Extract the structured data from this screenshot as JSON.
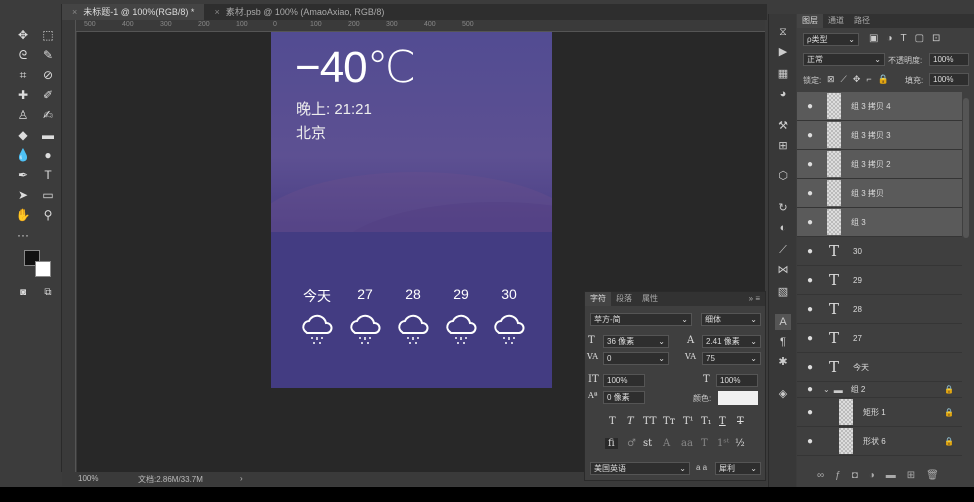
{
  "tabs": [
    {
      "label": "未标题-1 @ 100%(RGB/8) *",
      "active": true
    },
    {
      "label": "素材.psb @ 100% (AmaoAxiao, RGB/8)",
      "active": false
    }
  ],
  "ruler": [
    "500",
    "400",
    "300",
    "200",
    "100",
    "0",
    "100",
    "200",
    "300",
    "400",
    "500"
  ],
  "status": {
    "zoom": "100%",
    "doc": "文档:2.86M/33.7M",
    "arrow": "›"
  },
  "weather": {
    "temp": "−40",
    "unit": "℃",
    "time": "晚上:  21:21",
    "city": "北京",
    "forecast": [
      "今天",
      "27",
      "28",
      "29",
      "30"
    ]
  },
  "character": {
    "tabs": [
      "字符",
      "段落",
      "属性"
    ],
    "font": "苹方-简",
    "style": "细体",
    "size": "36 像素",
    "leading": "2.41 像素",
    "kerning": "0",
    "tracking": "75",
    "vscale": "100%",
    "hscale": "100%",
    "baseline": "0 像素",
    "color_label": "颜色:",
    "language": "美国英语",
    "aa_label": "a a",
    "antialias": "犀利",
    "text_color": "#f0f0f0"
  },
  "layers_panel": {
    "tabs": [
      "图层",
      "通道",
      "路径"
    ],
    "filter": "ρ类型",
    "blend": "正常",
    "opacity_label": "不透明度:",
    "opacity": "100%",
    "lock_label": "锁定:",
    "fill_label": "填充:",
    "fill": "100%",
    "layers": [
      {
        "name": "组 3 拷贝 4",
        "type": "smart"
      },
      {
        "name": "组 3 拷贝 3",
        "type": "smart"
      },
      {
        "name": "组 3 拷贝 2",
        "type": "smart"
      },
      {
        "name": "组 3 拷贝",
        "type": "smart"
      },
      {
        "name": "组 3",
        "type": "smart"
      },
      {
        "name": "30",
        "type": "text"
      },
      {
        "name": "29",
        "type": "text"
      },
      {
        "name": "28",
        "type": "text"
      },
      {
        "name": "27",
        "type": "text"
      },
      {
        "name": "今天",
        "type": "text"
      },
      {
        "name": "组 2",
        "type": "group"
      },
      {
        "name": "矩形 1",
        "type": "shape"
      },
      {
        "name": "形状 6",
        "type": "shape"
      }
    ]
  },
  "colors": {
    "doc_bg": "#4f4890",
    "selected_layer": "#5a5a5a"
  }
}
